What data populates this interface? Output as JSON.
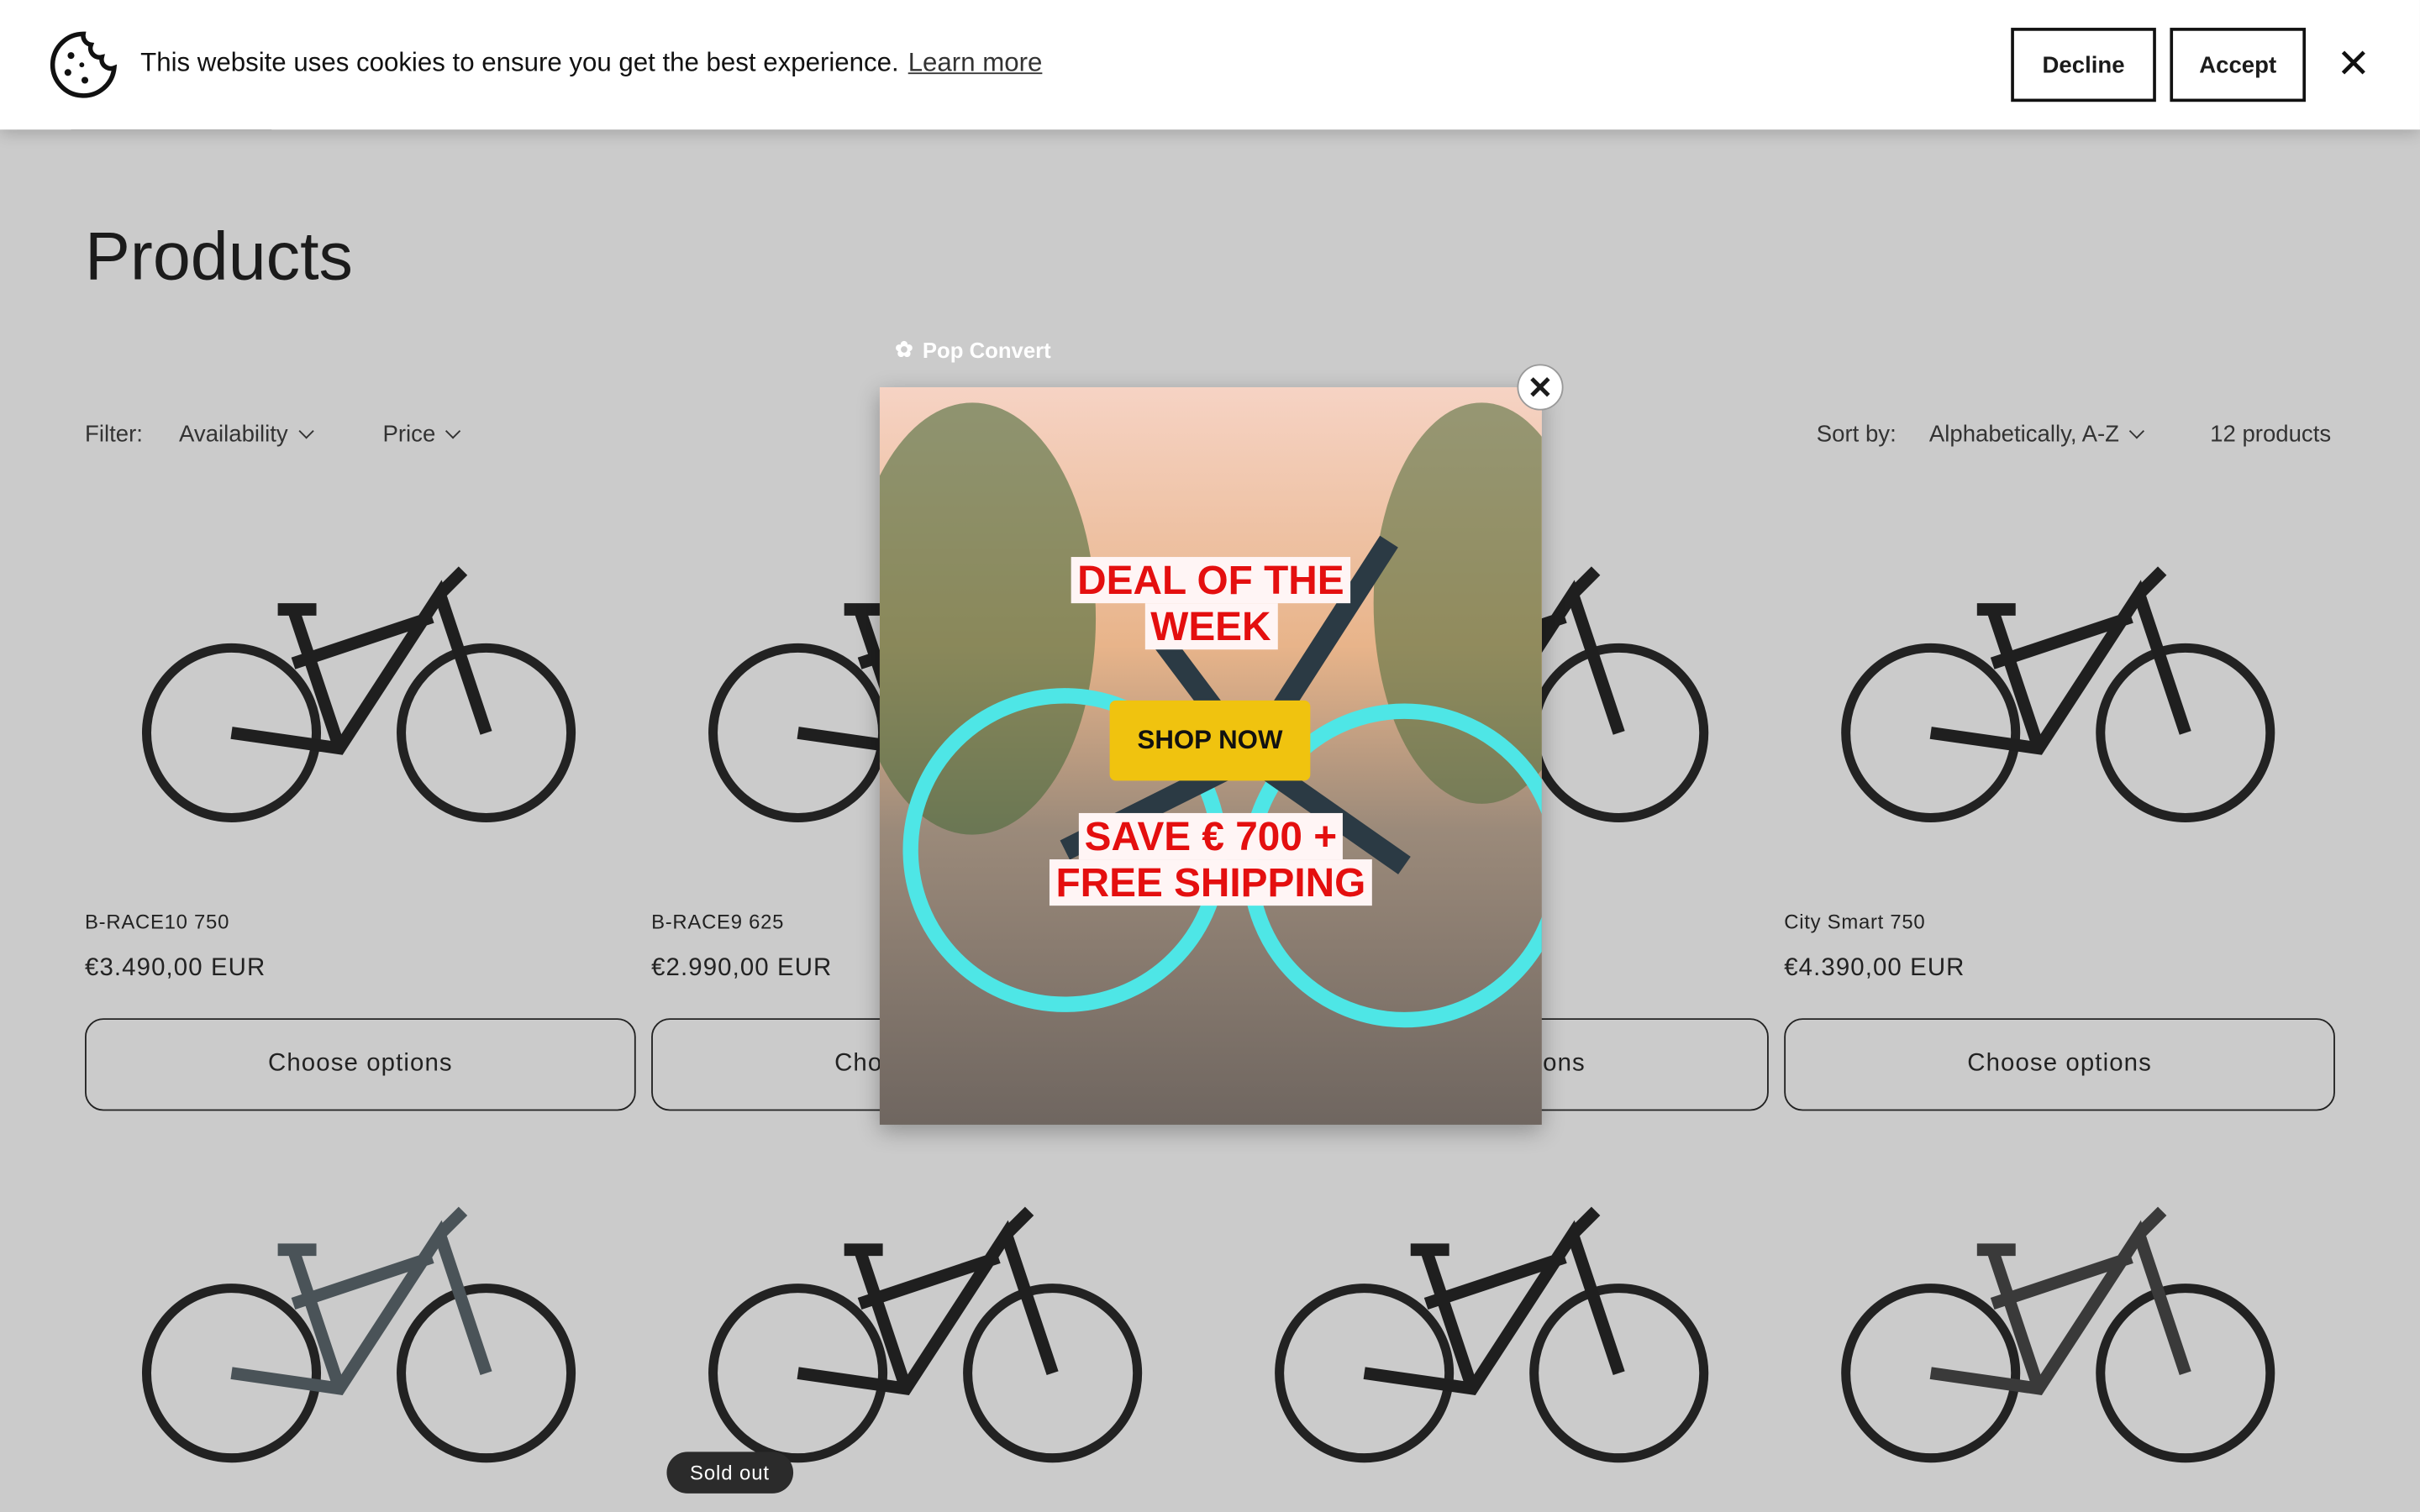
{
  "cookie_banner": {
    "message": "This website uses cookies to ensure you get the best experience.",
    "learn_more": "Learn more",
    "decline": "Decline",
    "accept": "Accept",
    "close_icon": "close-icon",
    "cookie_icon": "cookie-icon"
  },
  "page": {
    "title": "Products"
  },
  "filters": {
    "label": "Filter:",
    "availability": "Availability",
    "price": "Price",
    "sort_label": "Sort by:",
    "sort_value": "Alphabetically, A-Z",
    "count": "12 products"
  },
  "products": [
    {
      "name": "B-RACE10 750",
      "price": "€3.490,00 EUR",
      "button": "Choose options"
    },
    {
      "name": "B-RACE9 625",
      "price": "€2.990,00 EUR",
      "button": "Choose options"
    },
    {
      "name": "",
      "price": "",
      "button": "Choose options"
    },
    {
      "name": "City Smart 750",
      "price": "€4.390,00 EUR",
      "button": "Choose options"
    }
  ],
  "second_row": {
    "sold_out_badge": "Sold out"
  },
  "popup": {
    "brand": "Pop Convert",
    "headline_1": "DEAL OF THE",
    "headline_2": "WEEK",
    "cta": "SHOP NOW",
    "offer_1": "SAVE € 700 +",
    "offer_2": "FREE SHIPPING",
    "colors": {
      "headline": "#e40f0f",
      "cta_bg": "#f0c30f"
    }
  }
}
